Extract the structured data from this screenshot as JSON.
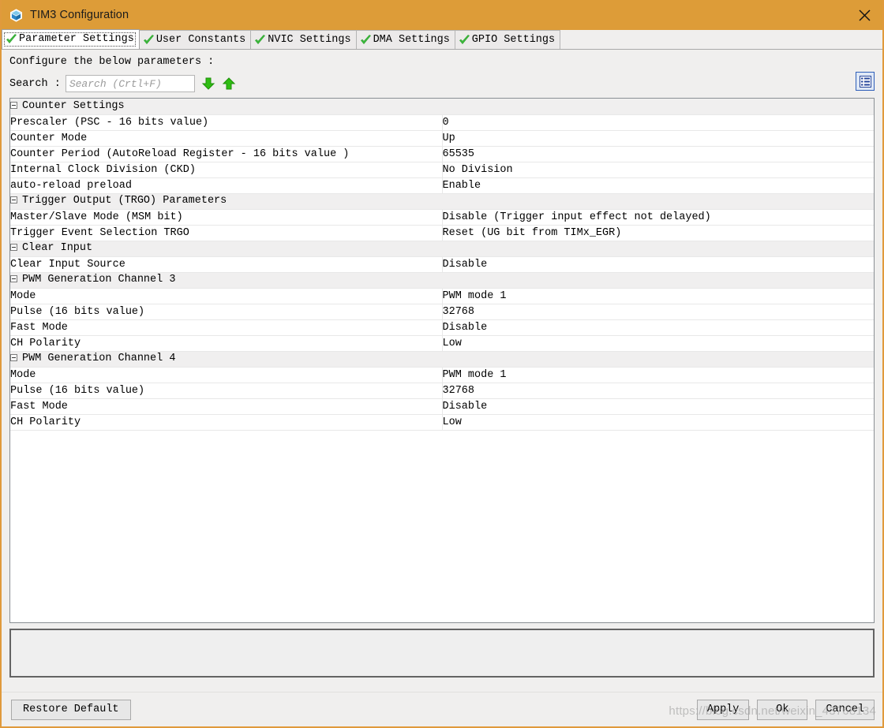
{
  "window": {
    "title": "TIM3 Configuration",
    "app_icon": "cube-icon",
    "close_icon": "close-icon",
    "titlebar_color": "#dd9c38"
  },
  "tabs": [
    {
      "label": "Parameter Settings",
      "icon": "green-check-icon",
      "selected": true
    },
    {
      "label": "User Constants",
      "icon": "green-check-icon",
      "selected": false
    },
    {
      "label": "NVIC Settings",
      "icon": "green-check-icon",
      "selected": false
    },
    {
      "label": "DMA Settings",
      "icon": "green-check-icon",
      "selected": false
    },
    {
      "label": "GPIO Settings",
      "icon": "green-check-icon",
      "selected": false
    }
  ],
  "panel": {
    "configure_text": "Configure the below parameters :",
    "search_label": "Search :",
    "search_value": "",
    "search_placeholder": "Search (Crtl+F)",
    "search_next_icon": "arrow-down-icon",
    "search_prev_icon": "arrow-up-icon",
    "list_toggle_icon": "list-view-icon"
  },
  "groups": [
    {
      "name": "Counter Settings",
      "rows": [
        {
          "name": "Prescaler (PSC - 16 bits value)",
          "value": "0"
        },
        {
          "name": "Counter Mode",
          "value": "Up"
        },
        {
          "name": "Counter Period (AutoReload Register - 16 bits value )",
          "value": "65535"
        },
        {
          "name": "Internal Clock Division (CKD)",
          "value": "No Division"
        },
        {
          "name": "auto-reload preload",
          "value": "Enable"
        }
      ]
    },
    {
      "name": "Trigger Output (TRGO) Parameters",
      "rows": [
        {
          "name": "Master/Slave Mode (MSM bit)",
          "value": "Disable (Trigger input effect not delayed)"
        },
        {
          "name": "Trigger Event Selection TRGO",
          "value": "Reset (UG bit from TIMx_EGR)"
        }
      ]
    },
    {
      "name": "Clear Input",
      "rows": [
        {
          "name": "Clear Input Source",
          "value": "Disable"
        }
      ]
    },
    {
      "name": "PWM Generation Channel 3",
      "rows": [
        {
          "name": "Mode",
          "value": "PWM mode 1"
        },
        {
          "name": "Pulse (16 bits value)",
          "value": "32768"
        },
        {
          "name": "Fast Mode",
          "value": "Disable"
        },
        {
          "name": "CH Polarity",
          "value": "Low"
        }
      ]
    },
    {
      "name": "PWM Generation Channel 4",
      "rows": [
        {
          "name": "Mode",
          "value": "PWM mode 1"
        },
        {
          "name": "Pulse (16 bits value)",
          "value": "32768"
        },
        {
          "name": "Fast Mode",
          "value": "Disable"
        },
        {
          "name": "CH Polarity",
          "value": "Low"
        }
      ]
    }
  ],
  "description_box": {
    "text": ""
  },
  "buttons": {
    "restore_default": "Restore Default",
    "apply": "Apply",
    "ok": "Ok",
    "cancel": "Cancel"
  },
  "watermark": "https://blog.csdn.net/weixin_43768134"
}
